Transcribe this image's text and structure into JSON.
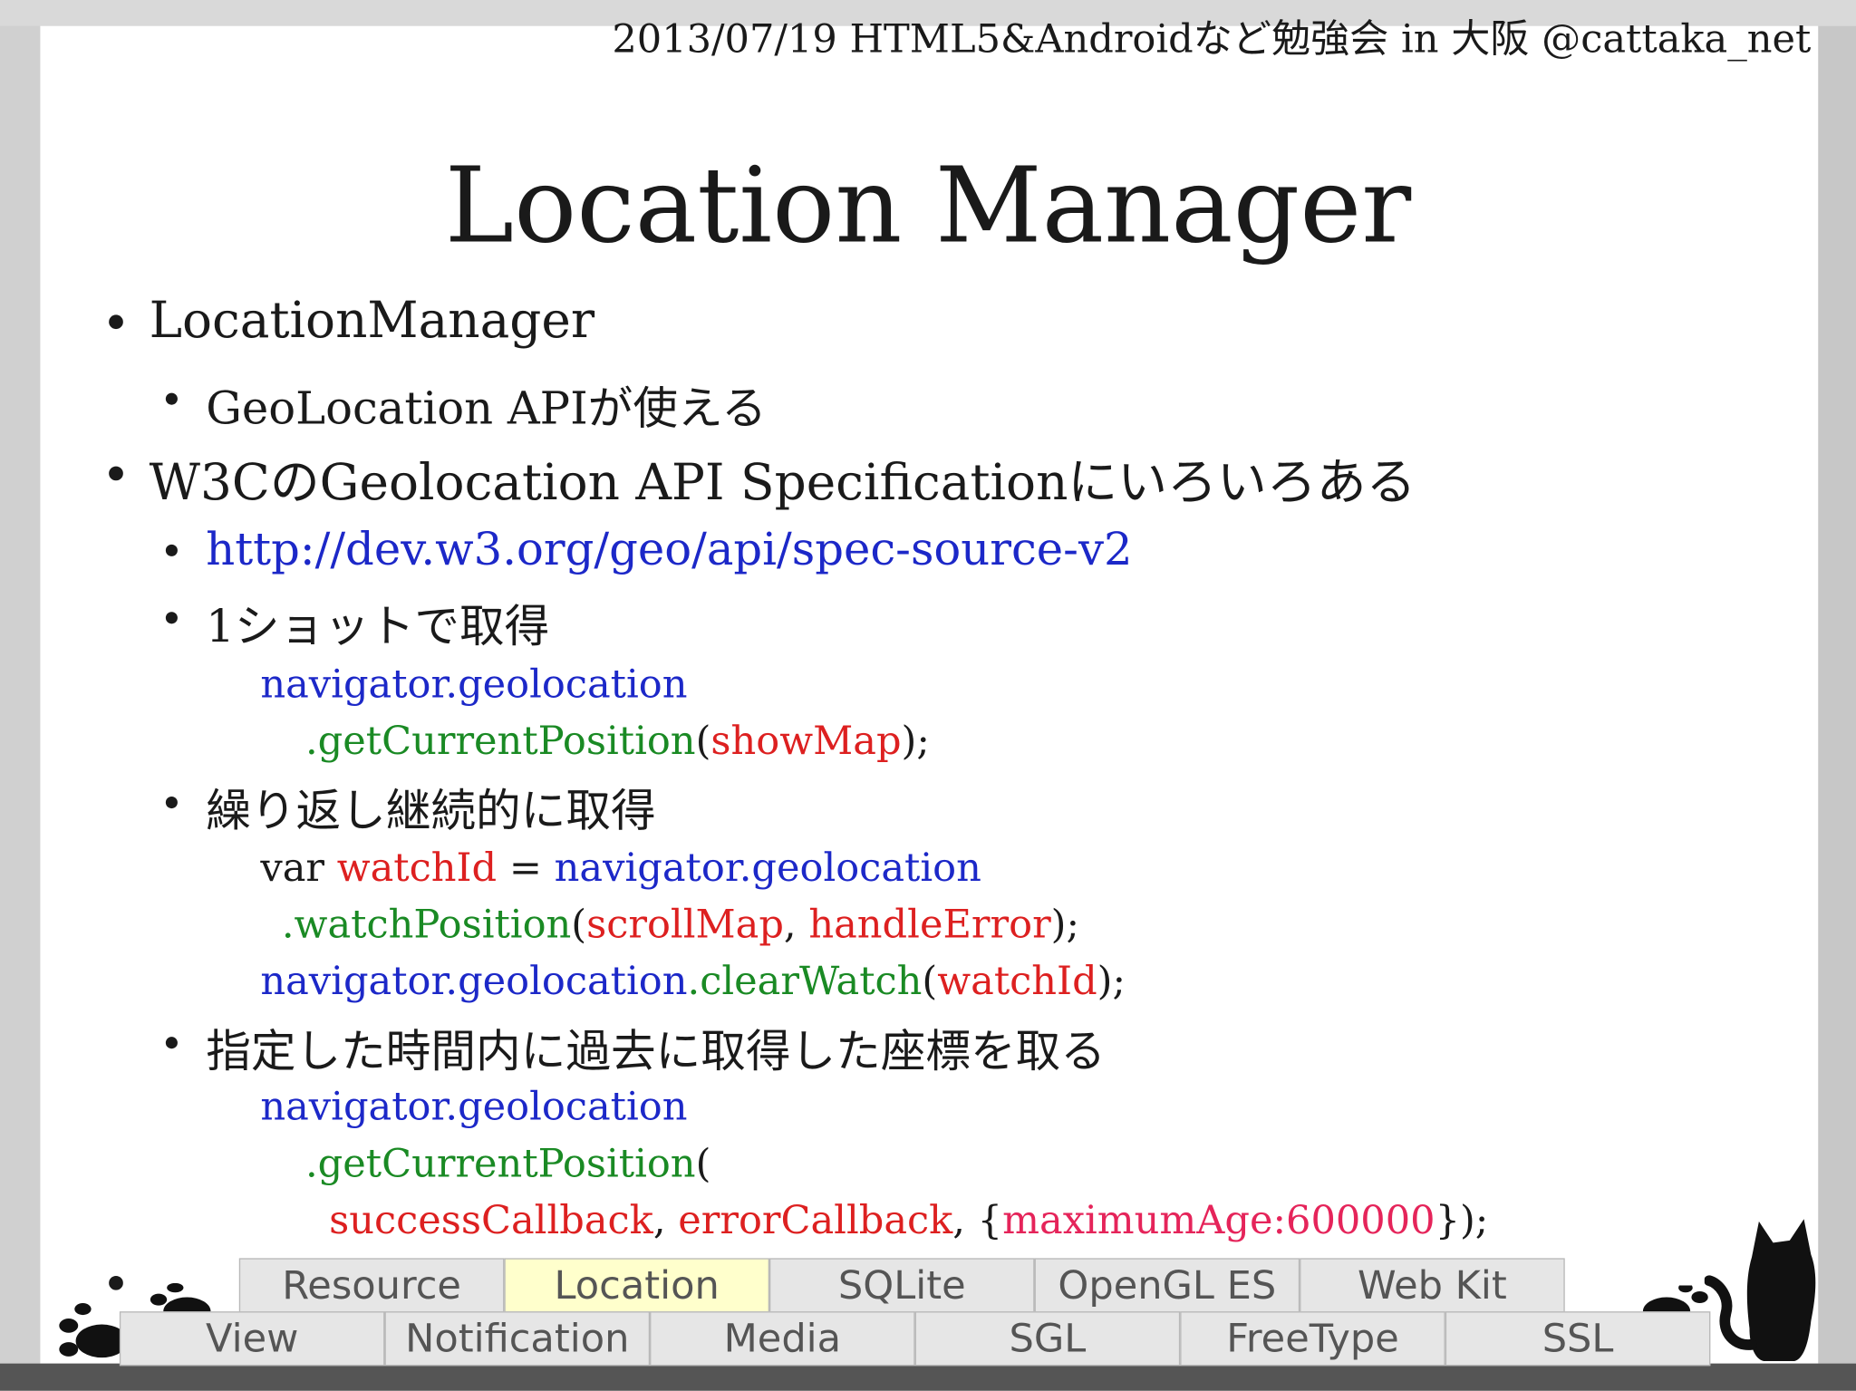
{
  "header": {
    "text": "2013/07/19 HTML5&Androidなど勉強会 in 大阪 @cattaka_net"
  },
  "title": "Location Manager",
  "bullets": {
    "b1": "LocationManager",
    "b1_sub": "GeoLocation APIが使える",
    "b2": "W3CのGeolocation API Specificationにいろいろある",
    "link": "http://dev.w3.org/geo/api/spec-source-v2",
    "oneshot": "1ショットで取得",
    "repeat": "繰り返し継続的に取得",
    "cached": "指定した時間内に過去に取得した座標を取る"
  },
  "code": {
    "c1_l1": "navigator.geolocation",
    "c1_l2_method": ".getCurrentPosition",
    "c1_l2_arg": "showMap",
    "c2_var": "var ",
    "c2_name": "watchId",
    "c2_eq": " = ",
    "c2_nav": "navigator.geolocation",
    "c2_method": ".watchPosition",
    "c2_arg1": "scrollMap",
    "c2_arg2": "handleError",
    "c2_clear_nav": "navigator.geolocation",
    "c2_clear_method": ".clearWatch",
    "c2_clear_arg": "watchId",
    "c3_l1": "navigator.geolocation",
    "c3_l2_method": ".getCurrentPosition",
    "c3_arg1": "successCallback",
    "c3_arg2": "errorCallback",
    "c3_opt": "maximumAge:600000"
  },
  "tabs_top": [
    "Resource",
    "Location",
    "SQLite",
    "OpenGL ES",
    "Web Kit"
  ],
  "tabs_bottom": [
    "View",
    "Notification",
    "Media",
    "SGL",
    "FreeType",
    "SSL"
  ],
  "active_tab": "Location"
}
